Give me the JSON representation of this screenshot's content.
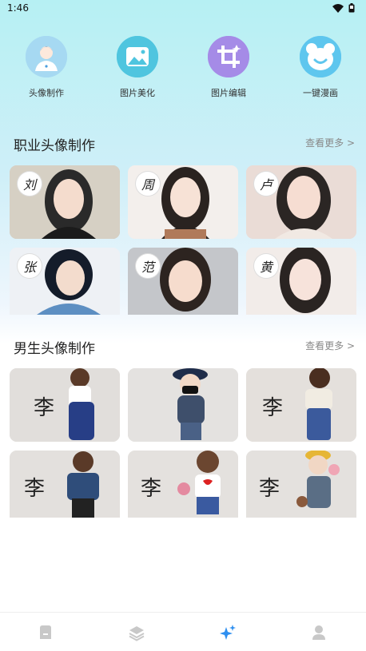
{
  "status_bar": {
    "time": "1:46"
  },
  "tools": [
    {
      "label": "头像制作",
      "icon": "avatar-icon",
      "color": "#8fd0ef"
    },
    {
      "label": "图片美化",
      "icon": "image-icon",
      "color": "#52c8e0"
    },
    {
      "label": "图片编辑",
      "icon": "crop-icon",
      "color": "#a98ee8"
    },
    {
      "label": "一键漫画",
      "icon": "bear-icon",
      "color": "#5fc7ef"
    }
  ],
  "sections": [
    {
      "title": "职业头像制作",
      "more": "查看更多 >",
      "items": [
        {
          "surname": "刘"
        },
        {
          "surname": "周"
        },
        {
          "surname": "卢"
        },
        {
          "surname": "张"
        },
        {
          "surname": "范"
        },
        {
          "surname": "黄"
        }
      ]
    },
    {
      "title": "男生头像制作",
      "more": "查看更多 >",
      "items": [
        {
          "surname": "李"
        },
        {
          "surname": ""
        },
        {
          "surname": "李"
        },
        {
          "surname": "李"
        },
        {
          "surname": "李"
        },
        {
          "surname": "李"
        }
      ]
    }
  ],
  "bottom_nav": [
    {
      "icon": "home-icon",
      "active": false
    },
    {
      "icon": "layers-icon",
      "active": false
    },
    {
      "icon": "sparkle-icon",
      "active": true
    },
    {
      "icon": "profile-icon",
      "active": false
    }
  ],
  "colors": {
    "accent": "#2e8ff0",
    "nav_inactive": "#c8c8c8"
  }
}
